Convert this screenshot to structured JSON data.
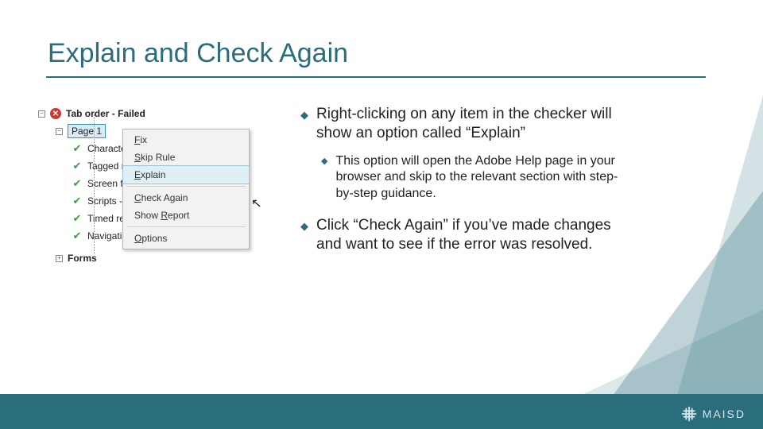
{
  "title": "Explain and Check Again",
  "checker": {
    "fail_label": "Tab order - Failed",
    "page_label": "Page 1",
    "items": [
      "Characte",
      "Tagged r",
      "Screen fl",
      "Scripts -",
      "Timed re",
      "Navigati"
    ],
    "forms_label": "Forms"
  },
  "context_menu": {
    "fix": "Fix",
    "skip": "Skip Rule",
    "explain": "Explain",
    "check": "Check Again",
    "report": "Show Report",
    "options": "Options"
  },
  "bullets": {
    "b1": "Right-clicking on any item in the checker will show an option called “Explain”",
    "b1a": "This option will open the Adobe Help page in your browser and skip to the relevant section with step-by-step guidance.",
    "b2": "Click “Check Again” if you’ve made changes and want to see if the error was resolved."
  },
  "footer": {
    "brand": "MAISD"
  }
}
